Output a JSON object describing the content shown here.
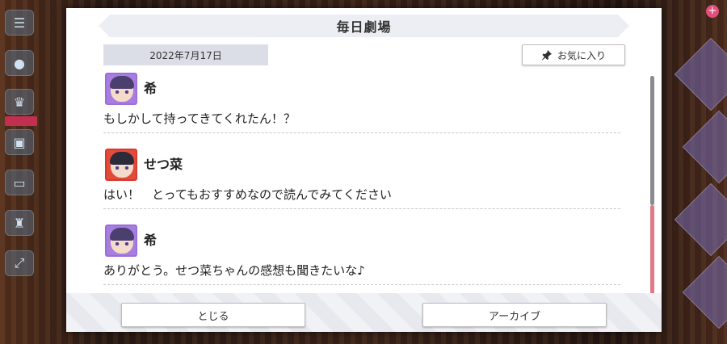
{
  "dialog": {
    "title": "毎日劇場",
    "date": "2022年7月17日",
    "favorite_label": "お気に入り"
  },
  "messages": [
    {
      "speaker": "希",
      "text": "もしかして持ってきてくれたん！？",
      "avatar_color": "#a77de0"
    },
    {
      "speaker": "せつ菜",
      "text": "はい！　とってもおすすめなので読んでみてください",
      "avatar_color": "#e24b3c"
    },
    {
      "speaker": "希",
      "text": "ありがとう。せつ菜ちゃんの感想も聞きたいな♪",
      "avatar_color": "#a77de0"
    }
  ],
  "footer": {
    "close_label": "とじる",
    "archive_label": "アーカイブ"
  },
  "colors": {
    "accent_scroll": "#e57886",
    "header_bg": "#eceef3"
  }
}
